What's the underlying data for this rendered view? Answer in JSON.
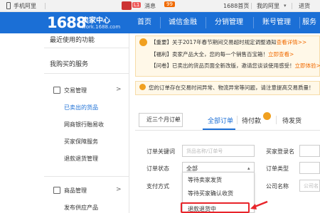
{
  "topbar": {
    "mobile_label": "手机阿里",
    "messages_label": "消息",
    "messages_count": "99",
    "l1_badge": "L1",
    "home_link": "1688首页",
    "my_ali_link": "我的阿里",
    "purchase_link": "进货"
  },
  "header": {
    "logo_number": "1688",
    "logo_title": "卖家中心",
    "logo_url": "work.1688.com",
    "nav": [
      "首页",
      "诚信金融",
      "分销管理",
      "账号管理",
      "服务"
    ]
  },
  "sidebar": {
    "recent_title": "最近使用的功能",
    "bought_title": "我购买的服务",
    "trade_group": "交易管理",
    "trade_items": [
      "已卖出的货品",
      "网商银行融易收",
      "买家保障服务",
      "退款退货管理"
    ],
    "product_group": "商品管理",
    "product_items": [
      "发布供应产品"
    ]
  },
  "notices": [
    {
      "tag": "【重要】",
      "text": "关于2017年春节期间交易超时规定调整通知",
      "link": "查看详情>>"
    },
    {
      "tag": "【福利】",
      "text": "卖家产品大全，您的每一个销售百宝箱！",
      "link": "立即查看>"
    },
    {
      "tag": "【问卷】",
      "text": "已卖出的货品页面全新改版，邀请您谈谈使用感受！",
      "link": "立即体验>>"
    }
  ],
  "warning": "您的订单存在交易时间异常、物流异常等问题，请注意提高交易质量！",
  "order_tabs": {
    "time_range": "近三个月订单",
    "tabs": [
      "全部订单",
      "待付款",
      "待发货"
    ]
  },
  "filters": {
    "keyword_label": "订单关键词",
    "keyword_placeholder": "货品名称/订单号",
    "buyer_login_label": "买家登录名",
    "status_label": "订单状态",
    "status_value": "全部",
    "order_type_label": "订单类型",
    "payment_label": "支付方式",
    "company_label": "公司名称",
    "company_placeholder": "公司名"
  },
  "status_dropdown": {
    "options": [
      "等待卖家发货",
      "等待买家确认收货",
      "退款退货中"
    ],
    "highlighted": "退款退货中"
  },
  "colors": {
    "brand_blue": "#1b6fd6",
    "accent_orange": "#f06a00",
    "highlight_red": "#e8242a"
  }
}
